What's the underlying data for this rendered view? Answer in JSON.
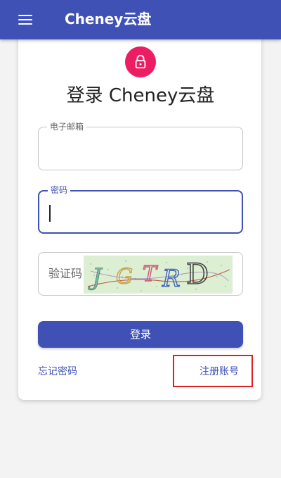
{
  "appbar": {
    "title": "Cheney云盘",
    "menu_icon": "menu-icon"
  },
  "login": {
    "avatar_icon": "lock-icon",
    "avatar_color": "#ec1d62",
    "title": "登录 Cheney云盘",
    "email_label": "电子邮箱",
    "email_value": "",
    "password_label": "密码",
    "password_value": "",
    "captcha_placeholder": "验证码",
    "captcha_image_text": "JGTRD",
    "submit_label": "登录",
    "forgot_link": "忘记密码",
    "register_link": "注册账号"
  },
  "theme": {
    "primary": "#3f51b5",
    "annotation": "#e02020"
  }
}
